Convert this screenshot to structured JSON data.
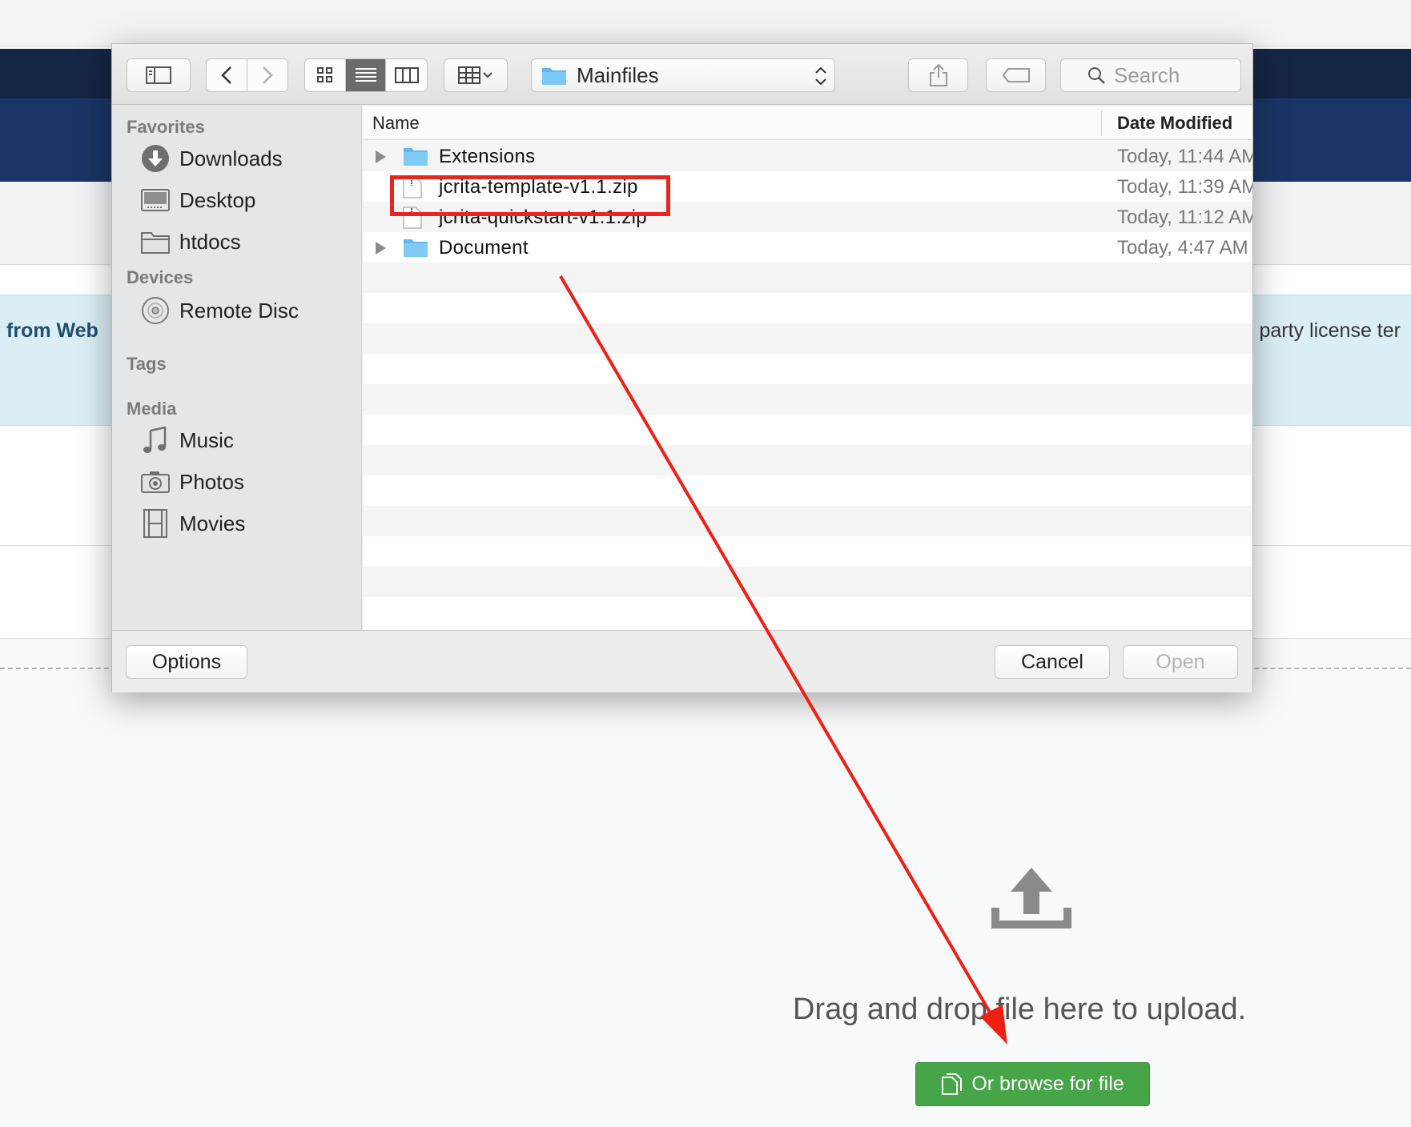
{
  "background_page": {
    "alert_left_text": "from Web",
    "alert_right_text": "l party license ter",
    "drop_text": "Drag and drop file here to upload.",
    "browse_button_label": "Or browse for file"
  },
  "dialog": {
    "location": "Mainfiles",
    "search_placeholder": "Search",
    "sidebar": {
      "favorites_title": "Favorites",
      "favorites": [
        {
          "label": "Downloads",
          "icon": "downloads-icon"
        },
        {
          "label": "Desktop",
          "icon": "desktop-icon"
        },
        {
          "label": "htdocs",
          "icon": "folder-icon"
        }
      ],
      "devices_title": "Devices",
      "devices": [
        {
          "label": "Remote Disc",
          "icon": "disc-icon"
        }
      ],
      "tags_title": "Tags",
      "media_title": "Media",
      "media": [
        {
          "label": "Music",
          "icon": "music-icon"
        },
        {
          "label": "Photos",
          "icon": "camera-icon"
        },
        {
          "label": "Movies",
          "icon": "film-icon"
        }
      ]
    },
    "columns": {
      "name": "Name",
      "date": "Date Modified"
    },
    "files": [
      {
        "name": "Extensions",
        "date": "Today, 11:44 AM",
        "kind": "folder"
      },
      {
        "name": "jcrita-template-v1.1.zip",
        "date": "Today, 11:39 AM",
        "kind": "zip"
      },
      {
        "name": "jcrita-quickstart-v1.1.zip",
        "date": "Today, 11:12 AM",
        "kind": "zip"
      },
      {
        "name": "Document",
        "date": "Today, 4:47 AM",
        "kind": "folder"
      }
    ],
    "buttons": {
      "options": "Options",
      "cancel": "Cancel",
      "open": "Open"
    }
  },
  "colors": {
    "annotation_red": "#e8261f",
    "browse_green": "#46a546",
    "navbar": "#152544",
    "header": "#1a3565",
    "alert_bg": "#dbeef6"
  }
}
